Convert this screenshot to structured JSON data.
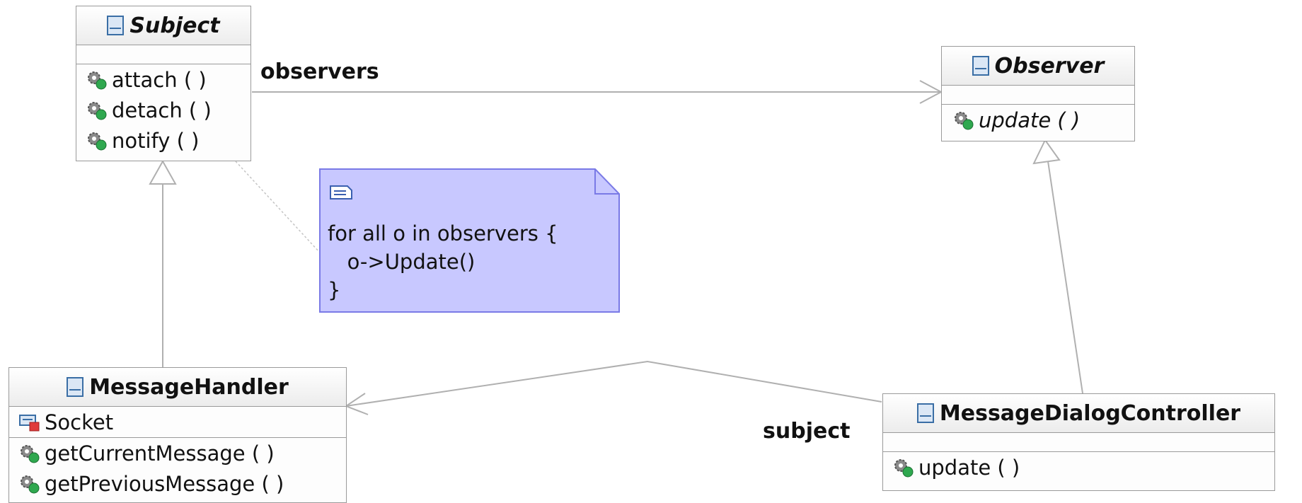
{
  "classes": {
    "subject": {
      "name": "Subject",
      "operations": [
        "attach ( )",
        "detach ( )",
        "notify ( )"
      ]
    },
    "observer": {
      "name": "Observer",
      "operations": [
        "update ( )"
      ]
    },
    "message_handler": {
      "name": "MessageHandler",
      "attributes": [
        "Socket"
      ],
      "operations": [
        "getCurrentMessage ( )",
        "getPreviousMessage ( )"
      ]
    },
    "message_dialog_controller": {
      "name": "MessageDialogController",
      "operations": [
        "update ( )"
      ]
    }
  },
  "note": {
    "text": "for all o in observers {\n   o->Update()\n}"
  },
  "associations": {
    "observers_label": "observers",
    "subject_label": "subject"
  },
  "colors": {
    "note_fill": "#c8c8ff",
    "note_border": "#7a7ae6",
    "line": "#b0b0b0",
    "class_border": "#9a9a9a"
  },
  "icons": {
    "class": "class-icon",
    "operation": "public-operation-icon",
    "field": "private-field-icon",
    "note": "note-icon"
  }
}
